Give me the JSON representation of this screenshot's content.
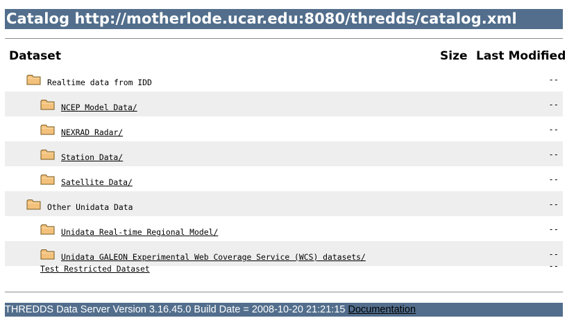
{
  "page": {
    "title": "Catalog http://motherlode.ucar.edu:8080/thredds/catalog.xml"
  },
  "table": {
    "headers": {
      "dataset": "Dataset",
      "size": "Size",
      "last_modified": "Last Modified"
    },
    "rows": [
      {
        "label": "Realtime data from IDD",
        "level": 0,
        "folder": true,
        "link": false,
        "last_modified": "--",
        "shaded": false
      },
      {
        "label": "NCEP Model Data/",
        "level": 1,
        "folder": true,
        "link": true,
        "last_modified": "--",
        "shaded": true
      },
      {
        "label": "NEXRAD Radar/",
        "level": 1,
        "folder": true,
        "link": true,
        "last_modified": "--",
        "shaded": false
      },
      {
        "label": "Station Data/",
        "level": 1,
        "folder": true,
        "link": true,
        "last_modified": "--",
        "shaded": true
      },
      {
        "label": "Satellite Data/",
        "level": 1,
        "folder": true,
        "link": true,
        "last_modified": "--",
        "shaded": false
      },
      {
        "label": "Other Unidata Data",
        "level": 0,
        "folder": true,
        "link": false,
        "last_modified": "--",
        "shaded": true
      },
      {
        "label": "Unidata Real-time Regional Model/",
        "level": 1,
        "folder": true,
        "link": true,
        "last_modified": "--",
        "shaded": false
      },
      {
        "label": "Unidata GALEON Experimental Web Coverage Service (WCS) datasets/",
        "level": 1,
        "folder": true,
        "link": true,
        "last_modified": "--",
        "shaded": true
      },
      {
        "label": "Test Restricted Dataset",
        "level": 1,
        "folder": false,
        "link": true,
        "last_modified": "--",
        "shaded": false
      }
    ]
  },
  "footer": {
    "version_text": "THREDDS Data Server Version 3.16.45.0 Build Date = 2008-10-20 21:21:15",
    "doc_link": "Documentation"
  },
  "colors": {
    "bar": "#526e8c",
    "row_shade": "#eeeeee",
    "folder_fill": "#f3c17b",
    "folder_edge": "#7a5a1e"
  },
  "icons": {
    "folder": "folder-icon"
  }
}
